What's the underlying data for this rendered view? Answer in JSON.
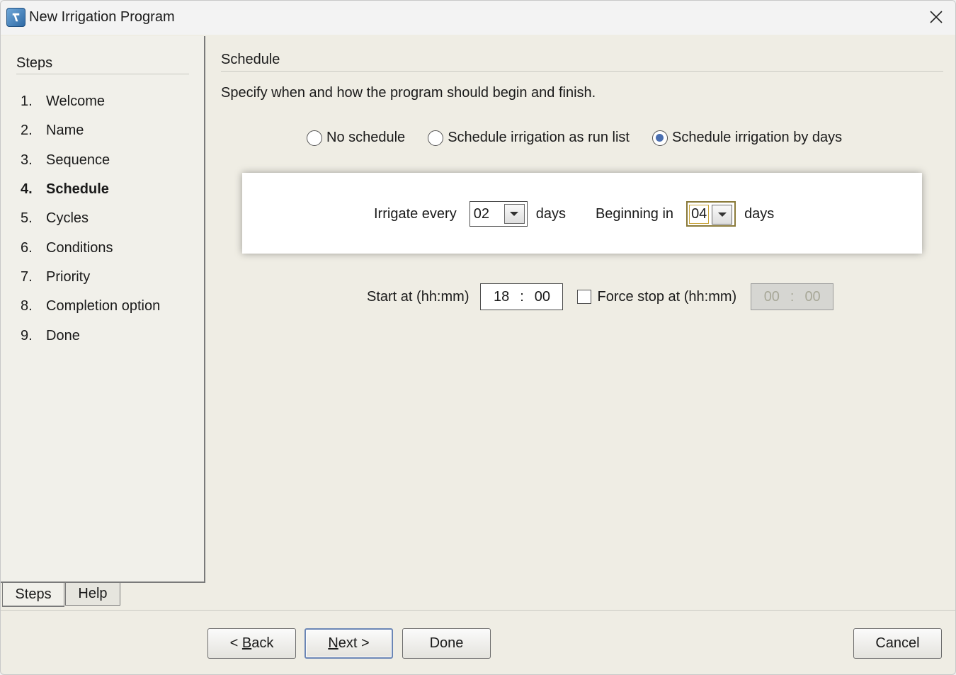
{
  "window": {
    "title": "New Irrigation Program"
  },
  "steps": {
    "title": "Steps",
    "items": [
      {
        "num": "1.",
        "label": "Welcome"
      },
      {
        "num": "2.",
        "label": "Name"
      },
      {
        "num": "3.",
        "label": "Sequence"
      },
      {
        "num": "4.",
        "label": "Schedule"
      },
      {
        "num": "5.",
        "label": "Cycles"
      },
      {
        "num": "6.",
        "label": "Conditions"
      },
      {
        "num": "7.",
        "label": "Priority"
      },
      {
        "num": "8.",
        "label": "Completion option"
      },
      {
        "num": "9.",
        "label": "Done"
      }
    ],
    "current_index": 3,
    "tabs": {
      "steps": "Steps",
      "help": "Help"
    }
  },
  "schedule": {
    "title": "Schedule",
    "description": "Specify when and how the program should begin and finish.",
    "radio_options": [
      {
        "label": "No schedule",
        "checked": false
      },
      {
        "label": "Schedule irrigation as run list",
        "checked": false
      },
      {
        "label": "Schedule irrigation by days",
        "checked": true
      }
    ],
    "irrigate_every_label": "Irrigate every",
    "irrigate_every_value": "02",
    "days_label": "days",
    "beginning_in_label": "Beginning in",
    "beginning_in_value": "04",
    "start_at_label": "Start at (hh:mm)",
    "start_hh": "18",
    "start_mm": "00",
    "time_sep": ":",
    "force_stop_label": "Force stop at (hh:mm)",
    "force_stop_checked": false,
    "stop_hh": "00",
    "stop_mm": "00"
  },
  "buttons": {
    "back_prefix": "< ",
    "back_mnemonic": "B",
    "back_rest": "ack",
    "next_mnemonic": "N",
    "next_rest": "ext >",
    "done": "Done",
    "cancel": "Cancel"
  }
}
